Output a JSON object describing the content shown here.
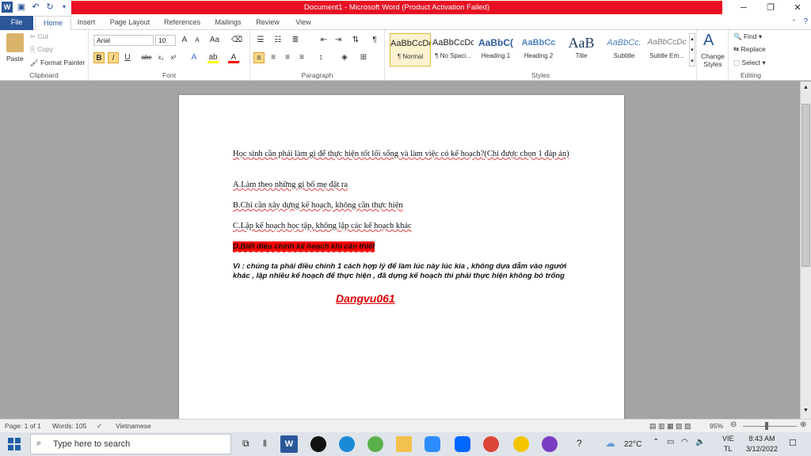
{
  "title": "Document1 - Microsoft Word (Product Activation Failed)",
  "tabs": [
    "File",
    "Home",
    "Insert",
    "Page Layout",
    "References",
    "Mailings",
    "Review",
    "View"
  ],
  "clipboard": {
    "paste": "Paste",
    "cut": "Cut",
    "copy": "Copy",
    "format_painter": "Format Painter",
    "label": "Clipboard"
  },
  "font": {
    "name": "Arial",
    "size": "10",
    "label": "Font"
  },
  "paragraph": {
    "label": "Paragraph"
  },
  "styles": {
    "label": "Styles",
    "items": [
      {
        "preview": "AaBbCcDc",
        "name": "¶ Normal"
      },
      {
        "preview": "AaBbCcDc",
        "name": "¶ No Spaci..."
      },
      {
        "preview": "AaBbC(",
        "name": "Heading 1"
      },
      {
        "preview": "AaBbCc",
        "name": "Heading 2"
      },
      {
        "preview": "AaB",
        "name": "Title"
      },
      {
        "preview": "AaBbCc.",
        "name": "Subtitle"
      },
      {
        "preview": "AaBbCcDc",
        "name": "Subtle Em..."
      }
    ],
    "change": "Change Styles"
  },
  "editing": {
    "find": "Find",
    "replace": "Replace",
    "select": "Select",
    "label": "Editing"
  },
  "document": {
    "question": "Học sinh cần phải làm gì để thực hiện tốt lối sống và làm việc có kế hoạch?(Chỉ được chọn 1 đáp án)",
    "a": "A.Làm theo những gì bố mẹ đặt ra",
    "b": "B.Chỉ cần xây dựng kế hoạch, không cần thực hiện",
    "c": "C.Lập kế hoạch học tập, không lập các kế hoạch khác",
    "d": "D.Biết điều chỉnh kế hoạch khi cần thiết",
    "explain": "Vì : chúng ta phải điều chỉnh 1 cách hợp lý để làm lúc này lúc kia , không dựa dẫm vào người khác , lập nhiều kế hoạch để thực hiện , đã dựng kế hoạch thì phải thực hiện không bỏ trống",
    "signature": "Dangvu061"
  },
  "status": {
    "page": "Page: 1 of 1",
    "words": "Words: 105",
    "language": "Vietnamese",
    "zoom": "95%"
  },
  "taskbar": {
    "search": "Type here to search",
    "weather": "22°C",
    "lang1": "VIE",
    "lang2": "TL",
    "time": "8:43 AM",
    "date": "3/12/2022"
  }
}
